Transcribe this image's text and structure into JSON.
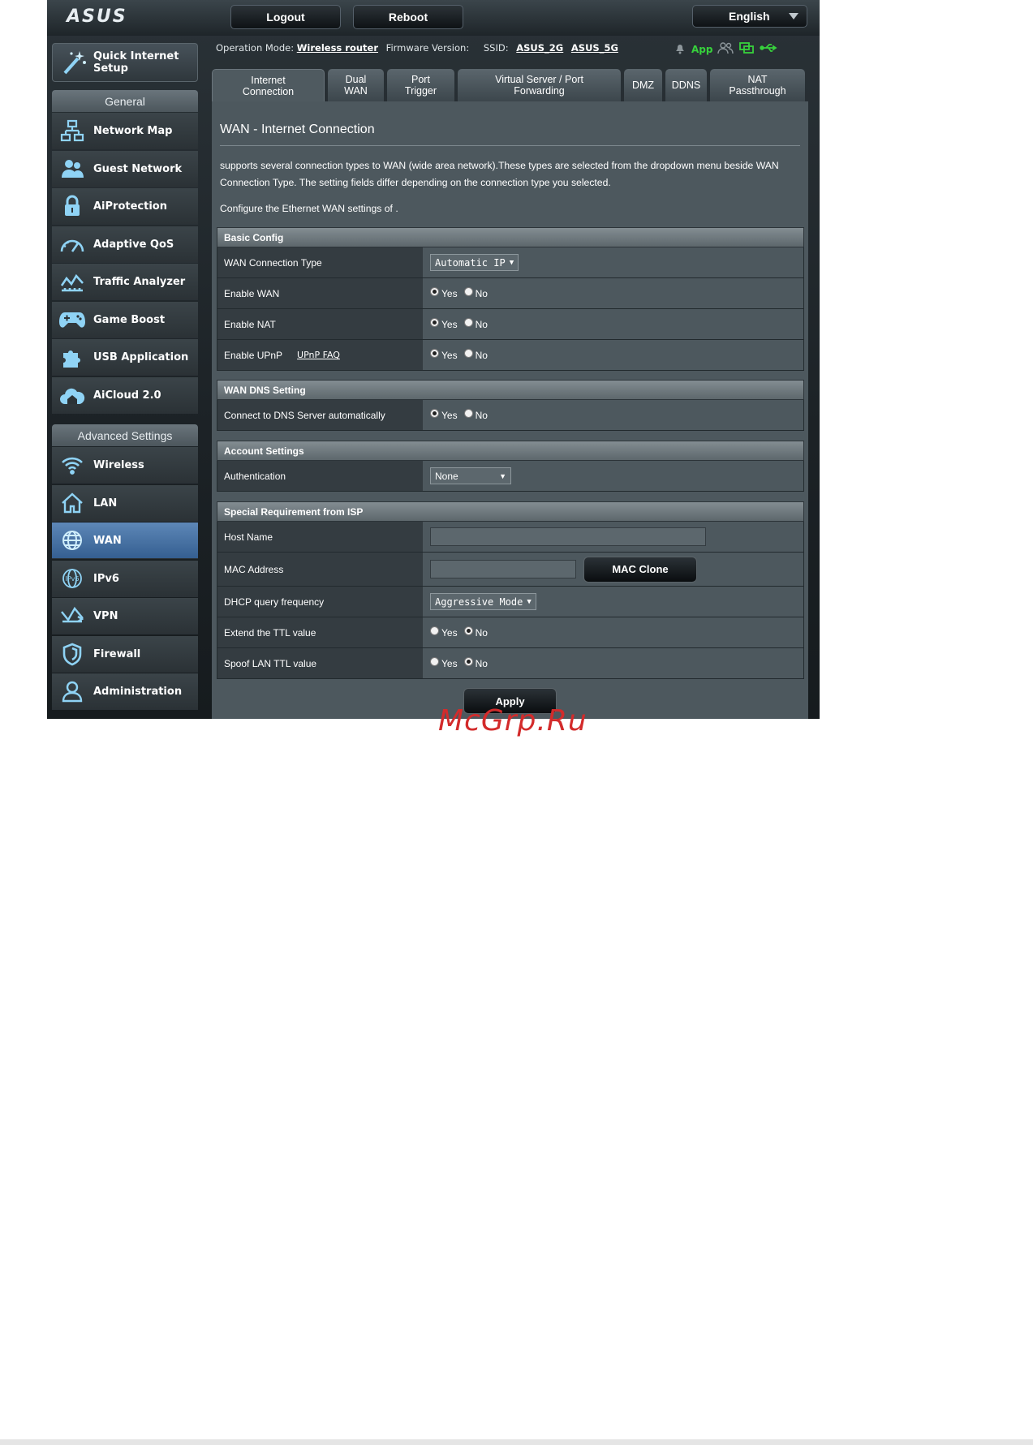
{
  "header": {
    "logo": "ASUS",
    "logout_label": "Logout",
    "reboot_label": "Reboot",
    "language": "English"
  },
  "status": {
    "op_mode_label": "Operation Mode:",
    "op_mode_value": "Wireless router",
    "firmware_label": "Firmware Version:",
    "ssid_label": "SSID:",
    "ssid_2g": "ASUS_2G",
    "ssid_5g": "ASUS_5G",
    "app_label": "App"
  },
  "sidebar": {
    "quick_setup": "Quick Internet\nSetup",
    "general_header": "General",
    "general_items": [
      {
        "label": "Network Map",
        "icon": "network-map-icon"
      },
      {
        "label": "Guest Network",
        "icon": "guest-network-icon"
      },
      {
        "label": "AiProtection",
        "icon": "lock-icon"
      },
      {
        "label": "Adaptive QoS",
        "icon": "gauge-icon"
      },
      {
        "label": "Traffic Analyzer",
        "icon": "traffic-chart-icon"
      },
      {
        "label": "Game Boost",
        "icon": "gamepad-icon"
      },
      {
        "label": "USB Application",
        "icon": "puzzle-icon"
      },
      {
        "label": "AiCloud 2.0",
        "icon": "cloud-home-icon"
      }
    ],
    "advanced_header": "Advanced Settings",
    "advanced_items": [
      {
        "label": "Wireless",
        "icon": "wifi-icon"
      },
      {
        "label": "LAN",
        "icon": "home-icon"
      },
      {
        "label": "WAN",
        "icon": "globe-icon",
        "active": true
      },
      {
        "label": "IPv6",
        "icon": "ipv6-globe-icon"
      },
      {
        "label": "VPN",
        "icon": "vpn-icon"
      },
      {
        "label": "Firewall",
        "icon": "shield-icon"
      },
      {
        "label": "Administration",
        "icon": "user-icon"
      }
    ]
  },
  "tabs": [
    {
      "label": "Internet\nConnection",
      "active": true
    },
    {
      "label": "Dual\nWAN"
    },
    {
      "label": "Port\nTrigger"
    },
    {
      "label": "Virtual Server / Port\nForwarding"
    },
    {
      "label": "DMZ"
    },
    {
      "label": "DDNS"
    },
    {
      "label": "NAT\nPassthrough"
    }
  ],
  "main": {
    "title": "WAN - Internet Connection",
    "description": "supports several connection types to WAN (wide area network).These types are selected from the dropdown menu beside WAN Connection Type. The setting fields differ depending on the connection type you selected.",
    "configure_text": "Configure the Ethernet WAN settings of ."
  },
  "basic_config": {
    "header": "Basic Config",
    "wan_type_label": "WAN Connection Type",
    "wan_type_value": "Automatic IP",
    "enable_wan_label": "Enable WAN",
    "enable_nat_label": "Enable NAT",
    "enable_upnp_label": "Enable UPnP",
    "upnp_faq": "UPnP  FAQ"
  },
  "dns": {
    "header": "WAN DNS Setting",
    "auto_dns_label": "Connect to DNS Server automatically"
  },
  "account": {
    "header": "Account Settings",
    "auth_label": "Authentication",
    "auth_value": "None"
  },
  "isp": {
    "header": "Special Requirement from ISP",
    "host_name_label": "Host Name",
    "host_name_value": "",
    "mac_label": "MAC Address",
    "mac_value": "",
    "mac_clone_label": "MAC Clone",
    "dhcp_label": "DHCP query frequency",
    "dhcp_value": "Aggressive Mode",
    "ttl_label": "Extend the TTL value",
    "spoof_label": "Spoof LAN TTL value"
  },
  "radio": {
    "yes": "Yes",
    "no": "No"
  },
  "apply_label": "Apply",
  "watermark": "McGrp.Ru",
  "colors": {
    "active_menu": "#4a77a8",
    "app_green": "#37d13c",
    "watermark_red": "#d32b2b"
  }
}
